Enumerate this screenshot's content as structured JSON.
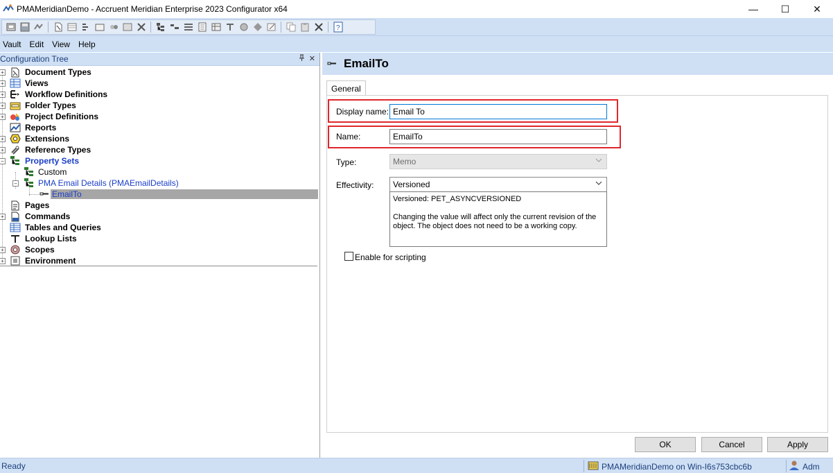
{
  "window": {
    "title": "PMAMeridianDemo - Accruent Meridian Enterprise 2023 Configurator x64",
    "minimize": "—",
    "maximize": "☐",
    "close": "✕"
  },
  "toolbar": {
    "buttons": [
      "open-icon",
      "save-icon",
      "sync-icon",
      "new-document-type-icon",
      "new-view-icon",
      "new-workflow-icon",
      "new-folder-type-icon",
      "new-project-icon",
      "new-report-icon",
      "tools-icon",
      "new-property-set-icon",
      "new-property-icon",
      "new-page-icon",
      "new-command-icon",
      "new-table-icon",
      "new-lookup-icon",
      "new-scope-icon",
      "environment-icon",
      "edit-icon",
      "copy-icon",
      "paste-icon",
      "delete-icon",
      "help-icon"
    ]
  },
  "menu": [
    "Vault",
    "Edit",
    "View",
    "Help"
  ],
  "left_panel": {
    "title": "Configuration Tree",
    "pin": "ℂ",
    "close": "✕",
    "tree": [
      {
        "label": "Document Types",
        "bold": true,
        "expander": "+",
        "icon": "document-types-icon"
      },
      {
        "label": "Views",
        "bold": true,
        "expander": "+",
        "icon": "views-icon"
      },
      {
        "label": "Workflow Definitions",
        "bold": true,
        "expander": "+",
        "icon": "workflow-icon"
      },
      {
        "label": "Folder Types",
        "bold": true,
        "expander": "+",
        "icon": "folder-types-icon"
      },
      {
        "label": "Project Definitions",
        "bold": true,
        "expander": "+",
        "icon": "project-definitions-icon"
      },
      {
        "label": "Reports",
        "bold": true,
        "expander": "",
        "icon": "reports-icon"
      },
      {
        "label": "Extensions",
        "bold": true,
        "expander": "+",
        "icon": "extensions-icon"
      },
      {
        "label": "Reference Types",
        "bold": true,
        "expander": "+",
        "icon": "reference-types-icon"
      },
      {
        "label": "Property Sets",
        "bold": true,
        "expander": "−",
        "icon": "property-sets-icon"
      },
      {
        "label": "Custom",
        "bold": false,
        "expander": "",
        "icon": "property-set-icon"
      },
      {
        "label": "PMA Email Details (PMAEmailDetails)",
        "bold": false,
        "expander": "−",
        "icon": "property-set-icon"
      },
      {
        "label": "EmailTo",
        "bold": false,
        "expander": "",
        "icon": "property-icon"
      },
      {
        "label": "Pages",
        "bold": true,
        "expander": "",
        "icon": "pages-icon"
      },
      {
        "label": "Commands",
        "bold": true,
        "expander": "+",
        "icon": "commands-icon"
      },
      {
        "label": "Tables and Queries",
        "bold": true,
        "expander": "",
        "icon": "tables-icon"
      },
      {
        "label": "Lookup Lists",
        "bold": true,
        "expander": "",
        "icon": "lookup-lists-icon"
      },
      {
        "label": "Scopes",
        "bold": true,
        "expander": "+",
        "icon": "scopes-icon"
      },
      {
        "label": "Environment",
        "bold": true,
        "expander": "+",
        "icon": "environment-icon"
      }
    ]
  },
  "detail": {
    "title": "EmailTo",
    "tab": "General",
    "display_name_label": "Display name:",
    "display_name_value": "Email To",
    "name_label": "Name:",
    "name_value": "EmailTo",
    "type_label": "Type:",
    "type_value": "Memo",
    "effectivity_label": "Effectivity:",
    "effectivity_value": "Versioned",
    "effectivity_desc_line1": "Versioned: PET_ASYNCVERSIONED",
    "effectivity_desc_line2": "Changing the value will affect only the current revision of the object. The object does not need to be a working copy.",
    "enable_scripting_label": "Enable for scripting",
    "enable_scripting_checked": false
  },
  "buttons": {
    "ok": "OK",
    "cancel": "Cancel",
    "apply": "Apply"
  },
  "status": {
    "left": "Ready",
    "server": "PMAMeridianDemo on Win-I6s753cbc6b",
    "user": "Adm"
  },
  "colors": {
    "chrome": "#cfe0f5",
    "highlight": "#e0262c",
    "link": "#1a3ec7"
  }
}
